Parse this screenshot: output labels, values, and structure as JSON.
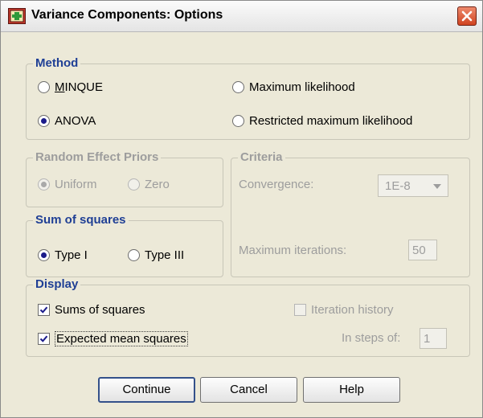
{
  "window": {
    "title": "Variance Components: Options",
    "close_icon": "close-x-icon",
    "app_icon": "spss-dialog-icon"
  },
  "method": {
    "title": "Method",
    "options": [
      {
        "label": "MINQUE",
        "mnemonic": "M",
        "checked": false
      },
      {
        "label": "Maximum likelihood",
        "mnemonic": "k",
        "checked": false
      },
      {
        "label": "ANOVA",
        "mnemonic": "A",
        "checked": true
      },
      {
        "label": "Restricted maximum likelihood",
        "mnemonic": "R",
        "checked": false
      }
    ]
  },
  "random_effect_priors": {
    "title": "Random Effect Priors",
    "options": [
      {
        "label": "Uniform",
        "checked": true,
        "enabled": false
      },
      {
        "label": "Zero",
        "checked": false,
        "enabled": false
      }
    ]
  },
  "criteria": {
    "title": "Criteria",
    "convergence_label": "Convergence:",
    "convergence_value": "1E-8",
    "max_iterations_label": "Maximum iterations:",
    "max_iterations_value": "50"
  },
  "sum_of_squares": {
    "title": "Sum of squares",
    "options": [
      {
        "label": "Type I",
        "checked": true
      },
      {
        "label": "Type III",
        "checked": false
      }
    ]
  },
  "display": {
    "title": "Display",
    "sums_of_squares": {
      "label": "Sums of squares",
      "checked": true
    },
    "expected_mean_squares": {
      "label": "Expected mean squares",
      "checked": true
    },
    "iteration_history": {
      "label": "Iteration history",
      "checked": false,
      "enabled": false
    },
    "in_steps_label": "In steps of:",
    "in_steps_value": "1"
  },
  "buttons": {
    "continue": "Continue",
    "cancel": "Cancel",
    "help": "Help"
  },
  "colors": {
    "group_title": "#1f3f95",
    "dialog_bg": "#ece9d8",
    "disabled_text": "#9d9d9d"
  }
}
